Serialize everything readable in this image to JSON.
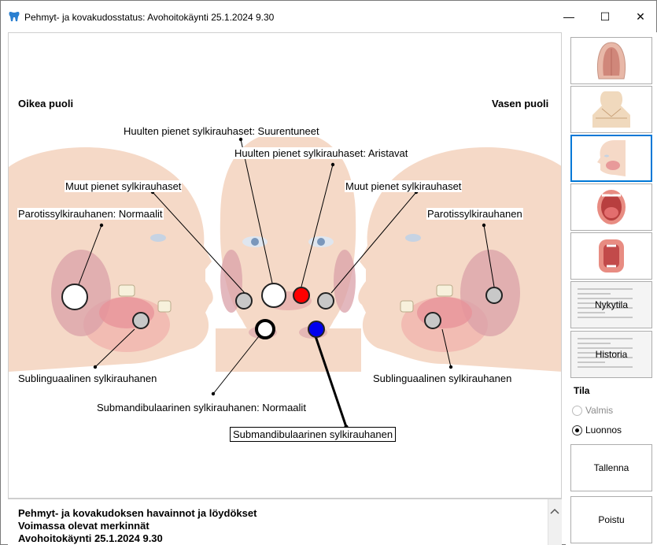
{
  "window": {
    "title": "Pehmyt- ja kovakudosstatus: Avohoitokäynti 25.1.2024 9.30",
    "app_icon": "tooth-icon",
    "controls": {
      "minimize": "—",
      "maximize": "☐",
      "close": "✕"
    }
  },
  "diagram": {
    "right_side_heading": "Oikea puoli",
    "left_side_heading": "Vasen puoli",
    "labels": {
      "huulet_suurentuneet": "Huulten pienet sylkirauhaset: Suurentuneet",
      "huulet_aristavat": "Huulten pienet sylkirauhaset: Aristavat",
      "muut_right": "Muut pienet sylkirauhaset",
      "muut_left": "Muut pienet sylkirauhaset",
      "parotis_right": "Parotissylkirauhanen: Normaalit",
      "parotis_left": "Parotissylkirauhanen",
      "sublingual_right": "Sublinguaalinen sylkirauhanen",
      "sublingual_left": "Sublinguaalinen sylkirauhanen",
      "submandibular_normaalit": "Submandibulaarinen sylkirauhanen: Normaalit",
      "submandibular_selected": "Submandibulaarinen sylkirauhanen"
    },
    "marker_colors": {
      "normal": "#ffffff",
      "empty": "#c8c8c8",
      "red": "#ff0000",
      "blue": "#0000ee"
    }
  },
  "notes": {
    "line1": "Pehmyt- ja kovakudoksen havainnot ja löydökset",
    "line2": "Voimassa olevat merkinnät",
    "line3": "Avohoitokäynti 25.1.2024 9.30",
    "scroll_up_icon": "chevron-up-icon"
  },
  "right_panel": {
    "view_buttons": [
      {
        "name": "palate-view",
        "icon": "palate-icon"
      },
      {
        "name": "neck-view",
        "icon": "neck-icon"
      },
      {
        "name": "salivary-glands-view",
        "icon": "head-icon",
        "selected": true
      },
      {
        "name": "mouth-open-view",
        "icon": "mouth-icon"
      },
      {
        "name": "throat-view",
        "icon": "throat-icon"
      }
    ],
    "nykytila_label": "Nykytila",
    "historia_label": "Historia",
    "tila_heading": "Tila",
    "radio_valmis": "Valmis",
    "radio_luonnos": "Luonnos",
    "save_label": "Tallenna",
    "exit_label": "Poistu"
  }
}
